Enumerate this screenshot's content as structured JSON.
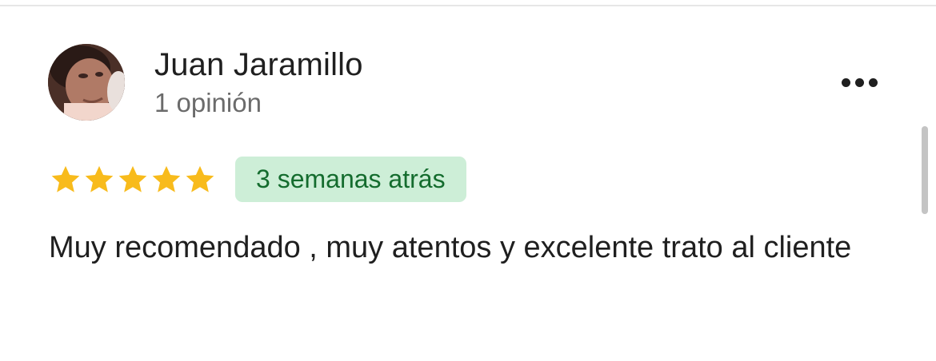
{
  "review": {
    "reviewer_name": "Juan Jaramillo",
    "review_count": "1 opinión",
    "rating": 5,
    "rating_max": 5,
    "time_ago": "3 semanas atrás",
    "text": "Muy recomendado , muy atentos y excelente trato al cliente"
  },
  "icons": {
    "more": "more-horizontal-icon",
    "star": "star-icon"
  },
  "colors": {
    "star": "#f8bb1c",
    "badge_bg": "#cdeed7",
    "badge_text": "#146c2e"
  }
}
